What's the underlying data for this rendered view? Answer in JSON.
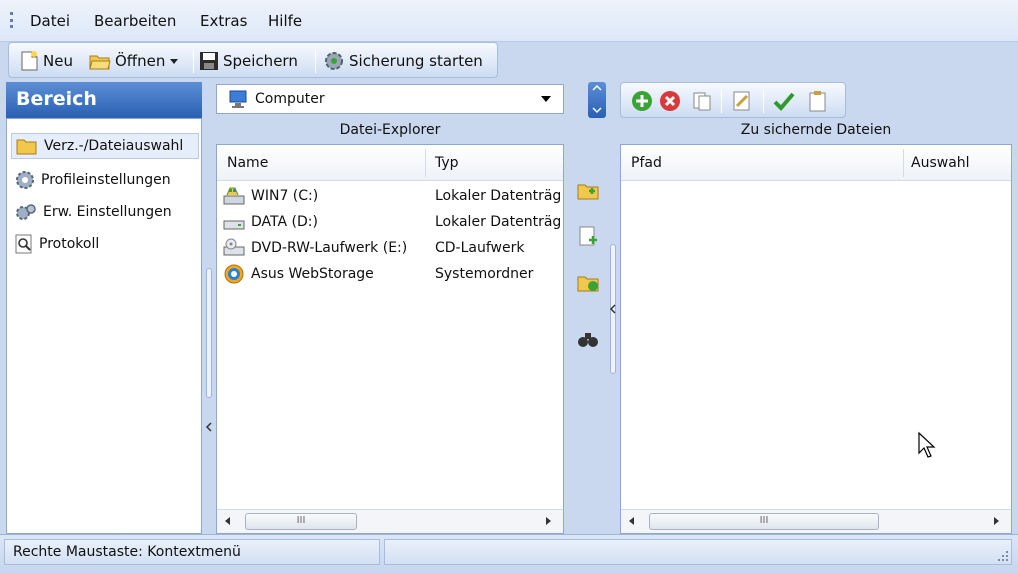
{
  "menu": {
    "items": [
      {
        "label": "Datei"
      },
      {
        "label": "Bearbeiten"
      },
      {
        "label": "Extras"
      },
      {
        "label": "Hilfe"
      }
    ]
  },
  "toolbar": {
    "new_label": "Neu",
    "open_label": "Öffnen",
    "save_label": "Speichern",
    "backup_label": "Sicherung starten"
  },
  "sidebar": {
    "title": "Bereich",
    "items": [
      {
        "label": "Verz.-/Dateiauswahl",
        "icon": "folder-icon",
        "selected": true
      },
      {
        "label": "Profileinstellungen",
        "icon": "profile-gear-icon",
        "selected": false
      },
      {
        "label": "Erw. Einstellungen",
        "icon": "advanced-settings-icon",
        "selected": false
      },
      {
        "label": "Protokoll",
        "icon": "magnifier-log-icon",
        "selected": false
      }
    ]
  },
  "location": {
    "selected": "Computer"
  },
  "explorer": {
    "title": "Datei-Explorer",
    "columns": [
      "Name",
      "Typ"
    ],
    "rows": [
      {
        "name": "WIN7 (C:)",
        "type": "Lokaler Datenträg",
        "icon": "system-drive-icon"
      },
      {
        "name": "DATA (D:)",
        "type": "Lokaler Datenträg",
        "icon": "drive-icon"
      },
      {
        "name": "DVD-RW-Laufwerk (E:)",
        "type": "CD-Laufwerk",
        "icon": "dvd-drive-icon"
      },
      {
        "name": "Asus WebStorage",
        "type": "Systemordner",
        "icon": "webstorage-icon"
      }
    ],
    "scroll_thumb": "III"
  },
  "backup_files": {
    "title": "Zu sichernde Dateien",
    "columns": [
      "Pfad",
      "Auswahl"
    ],
    "scroll_thumb": "III"
  },
  "status": {
    "text": "Rechte Maustaste: Kontextmenü"
  },
  "colors": {
    "header_blue": "#2a5fb3",
    "panel_bg": "#c9d8ef",
    "add_green": "#3aa335",
    "remove_red": "#d63a3a"
  }
}
